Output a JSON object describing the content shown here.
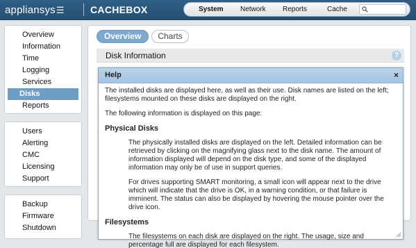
{
  "header": {
    "logo_text": "appliansys",
    "logo_glyph": "☰",
    "product": "CACHEBOX",
    "nav": [
      "System",
      "Network",
      "Reports",
      "Cache"
    ],
    "active_nav": "System",
    "search_placeholder": ""
  },
  "sidebar": {
    "group1": [
      "Overview",
      "Information",
      "Time",
      "Logging",
      "Services",
      "Disks",
      "Reports"
    ],
    "group2": [
      "Users",
      "Alerting",
      "CMC",
      "Licensing",
      "Support"
    ],
    "group3": [
      "Backup",
      "Firmware",
      "Shutdown"
    ],
    "active": "Disks"
  },
  "content": {
    "tabs": [
      "Overview",
      "Charts"
    ],
    "active_tab": "Overview",
    "section_title": "Disk Information",
    "help_icon": "?"
  },
  "help": {
    "title": "Help",
    "close": "×",
    "p1": "The installed disks are displayed here, as well as their use. Disk names are listed on the left; filesystems mounted on these disks are displayed on the right.",
    "p2": "The following information is displayed on this page:",
    "h_physical": "Physical Disks",
    "p3": "The physically installed disks are displayed on the left. Detailed information can be retrieved by clicking on the magnifying glass next to the disk name. The amount of information displayed will depend on the disk type, and some of the displayed information may only be of use in support queries.",
    "p4": "For drives supporting SMART monitoring, a small icon will appear next to the drive which will indicate that the drive is OK, in a warning condition, or that failure is imminent. The status can also be displayed by hovering the mouse pointer over the drive icon.",
    "h_fs": "Filesystems",
    "p5": "The filesystems on each disk are displayed on the right. The usage, size and percentage full are displayed for each filesystem."
  },
  "colors": {
    "header_bg": "#2f5e85",
    "accent": "#6e9ec6",
    "help_head": "#a5c5e2"
  }
}
